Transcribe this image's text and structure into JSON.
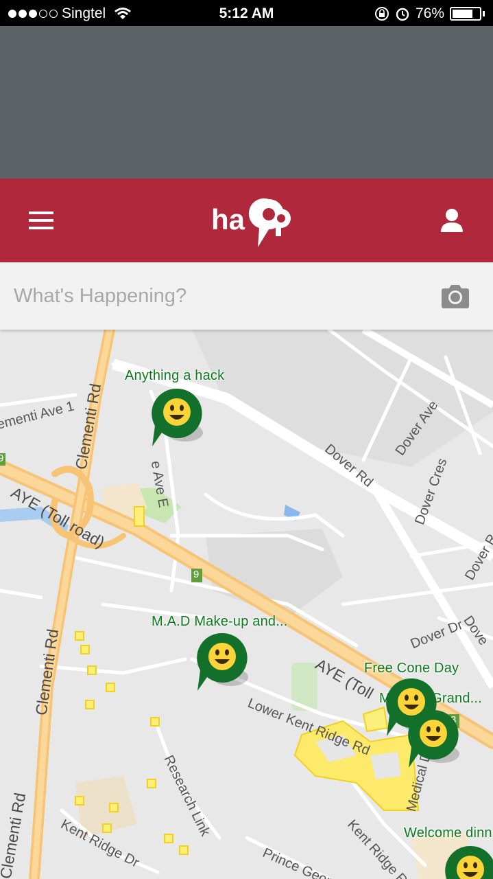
{
  "status_bar": {
    "carrier": "Singtel",
    "time": "5:12 AM",
    "battery": "76%",
    "battery_level": 0.76,
    "signal_dots_filled": 3,
    "signal_dots_total": 5
  },
  "app_bar": {
    "logo_text": "happ",
    "menu_icon": "hamburger-menu-icon",
    "profile_icon": "user-profile-icon"
  },
  "search": {
    "placeholder": "What's Happening?",
    "camera_icon": "camera-icon"
  },
  "map": {
    "roads": {
      "clementi_ave_1": "ementi Ave 1",
      "clementi_rd_top": "Clementi Rd",
      "dover_rd": "Dover Rd",
      "dover_ave": "Dover Ave",
      "dover_cres": "Dover Cres",
      "dover_rd_right": "Dover R",
      "aye_left": "AYE (Toll road)",
      "ave_e": "e Ave E",
      "clementi_rd_mid": "Clementi Rd",
      "dover_dr": "Dover Dr",
      "dove_right": "Dove",
      "aye_right": "AYE (Toll",
      "lower_kent_ridge": "Lower Kent Ridge Rd",
      "research_link": "Research Link",
      "medical_dr": "Medical Dr",
      "clementi_rd_bottom": "Clementi Rd",
      "kent_ridge_dr": "Kent Ridge Dr",
      "kent_ridge_rd": "Kent Ridge Rd",
      "prince_george": "Prince Geor",
      "shield_9a": "9",
      "shield_9b": "9",
      "shield_3": "3",
      "shield_left": "9"
    },
    "events": [
      {
        "label": "Anything a hack"
      },
      {
        "label": "M.A.D Make-up and..."
      },
      {
        "label": "Free Cone Day"
      },
      {
        "label": "Medical Grand..."
      },
      {
        "label": "Welcome dinn"
      }
    ],
    "pin_color": "#13702a",
    "pin_icon": "smiley-face-icon"
  }
}
